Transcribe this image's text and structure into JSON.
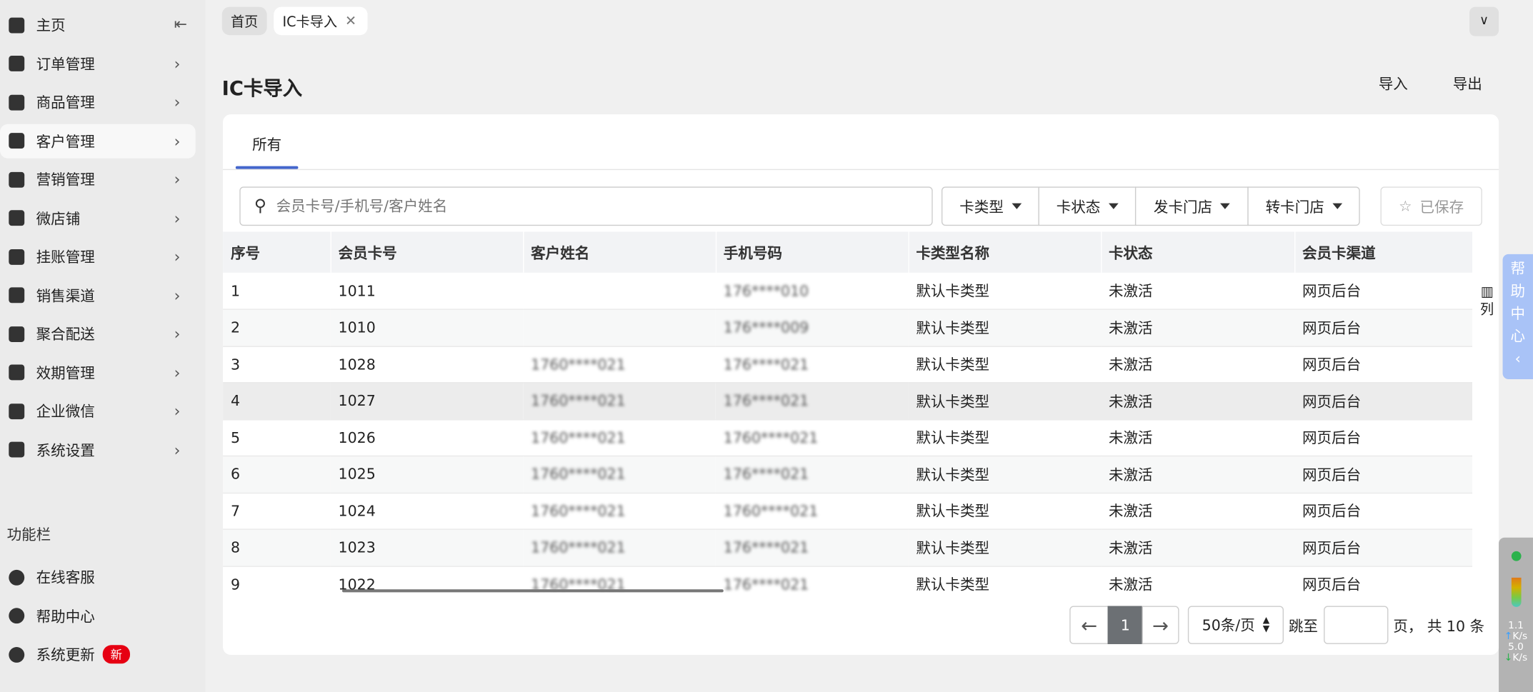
{
  "sidebar": {
    "items": [
      {
        "label": "主页",
        "icon": "home-icon"
      },
      {
        "label": "订单管理",
        "icon": "order-icon"
      },
      {
        "label": "商品管理",
        "icon": "goods-icon"
      },
      {
        "label": "客户管理",
        "icon": "user-icon"
      },
      {
        "label": "营销管理",
        "icon": "tag-icon"
      },
      {
        "label": "微店铺",
        "icon": "shop-icon"
      },
      {
        "label": "挂账管理",
        "icon": "ledger-icon"
      },
      {
        "label": "销售渠道",
        "icon": "bank-icon"
      },
      {
        "label": "聚合配送",
        "icon": "truck-icon"
      },
      {
        "label": "效期管理",
        "icon": "warehouse-icon"
      },
      {
        "label": "企业微信",
        "icon": "chat-icon"
      },
      {
        "label": "系统设置",
        "icon": "gear-icon"
      }
    ],
    "section_title": "功能栏",
    "tools": [
      {
        "label": "在线客服"
      },
      {
        "label": "帮助中心"
      },
      {
        "label": "系统更新",
        "badge": "新"
      }
    ]
  },
  "tabs": [
    {
      "label": "首页"
    },
    {
      "label": "IC卡导入"
    }
  ],
  "page": {
    "title": "IC卡导入",
    "import": "导入",
    "export": "导出"
  },
  "content_tabs": [
    {
      "label": "所有"
    }
  ],
  "search": {
    "placeholder": "会员卡号/手机号/客户姓名"
  },
  "filters": [
    {
      "label": "卡类型"
    },
    {
      "label": "卡状态"
    },
    {
      "label": "发卡门店"
    },
    {
      "label": "转卡门店"
    }
  ],
  "saved_label": "已保存",
  "columns_label": "列",
  "table": {
    "headers": [
      "序号",
      "会员卡号",
      "客户姓名",
      "手机号码",
      "卡类型名称",
      "卡状态",
      "会员卡渠道"
    ],
    "rows": [
      [
        "1",
        "1011",
        "",
        "176****010",
        "默认卡类型",
        "未激活",
        "网页后台"
      ],
      [
        "2",
        "1010",
        "",
        "176****009",
        "默认卡类型",
        "未激活",
        "网页后台"
      ],
      [
        "3",
        "1028",
        "1760****021",
        "176****021",
        "默认卡类型",
        "未激活",
        "网页后台"
      ],
      [
        "4",
        "1027",
        "1760****021",
        "176****021",
        "默认卡类型",
        "未激活",
        "网页后台"
      ],
      [
        "5",
        "1026",
        "1760****021",
        "1760****021",
        "默认卡类型",
        "未激活",
        "网页后台"
      ],
      [
        "6",
        "1025",
        "1760****021",
        "176****021",
        "默认卡类型",
        "未激活",
        "网页后台"
      ],
      [
        "7",
        "1024",
        "1760****021",
        "1760****021",
        "默认卡类型",
        "未激活",
        "网页后台"
      ],
      [
        "8",
        "1023",
        "1760****021",
        "176****021",
        "默认卡类型",
        "未激活",
        "网页后台"
      ],
      [
        "9",
        "1022",
        "1760****021",
        "176****021",
        "默认卡类型",
        "未激活",
        "网页后台"
      ]
    ]
  },
  "pagination": {
    "current": "1",
    "page_size": "50条/页",
    "jump_label": "跳至",
    "total_text": "页， 共 10 条"
  },
  "help_center": {
    "chars": [
      "帮",
      "助",
      "中",
      "心",
      "‹"
    ]
  },
  "network": {
    "up": "1.1",
    "down": "5.0",
    "unit": "K/s"
  },
  "colors": {
    "accent": "#4466cc",
    "badge": "#e60012",
    "help_bg": "#a9c3f7"
  }
}
